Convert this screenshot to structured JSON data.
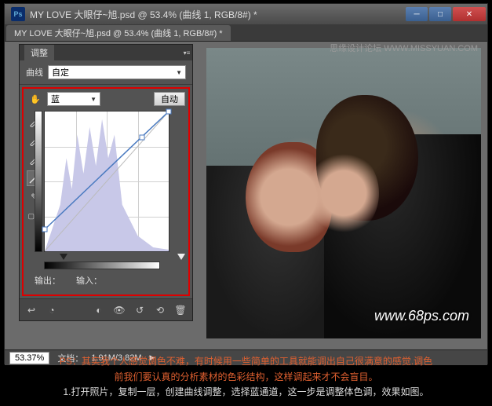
{
  "watermark_top": "思缘设计论坛 WWW.MISSYUAN.COM",
  "titlebar": {
    "ps": "Ps",
    "title": "MY LOVE   大眼仔~旭.psd @ 53.4% (曲线 1, RGB/8#) *"
  },
  "tab": "MY LOVE   大眼仔~旭.psd @ 53.4% (曲线 1, RGB/8#) *",
  "panel": {
    "tab": "调整",
    "preset_label": "曲线",
    "preset_value": "自定",
    "channel": "蓝",
    "auto": "自动",
    "output": "输出：",
    "input": "输入："
  },
  "watermark": "www.68ps.com",
  "status": {
    "zoom": "53.37%",
    "doc_label": "文档：",
    "doc": "1.91M/3.82M"
  },
  "caption": {
    "line1": "PS：其实我个人感觉调色不难，有时候用一些简单的工具就能调出自己很满意的感觉.调色",
    "line2": "前我们要认真的分析素材的色彩结构，这样调起来才不会盲目。",
    "line3": "1.打开照片，复制一层，创建曲线调整，选择蓝通道，这一步是调整体色调，效果如图。"
  },
  "chart_data": {
    "type": "curve",
    "channel": "blue",
    "x_range": [
      0,
      255
    ],
    "y_range": [
      0,
      255
    ],
    "points": [
      {
        "x": 0,
        "y": 40
      },
      {
        "x": 200,
        "y": 208
      },
      {
        "x": 255,
        "y": 255
      }
    ],
    "histogram_hint": "dense mid-tones with spikes around 60-140",
    "grid": "4x4"
  }
}
